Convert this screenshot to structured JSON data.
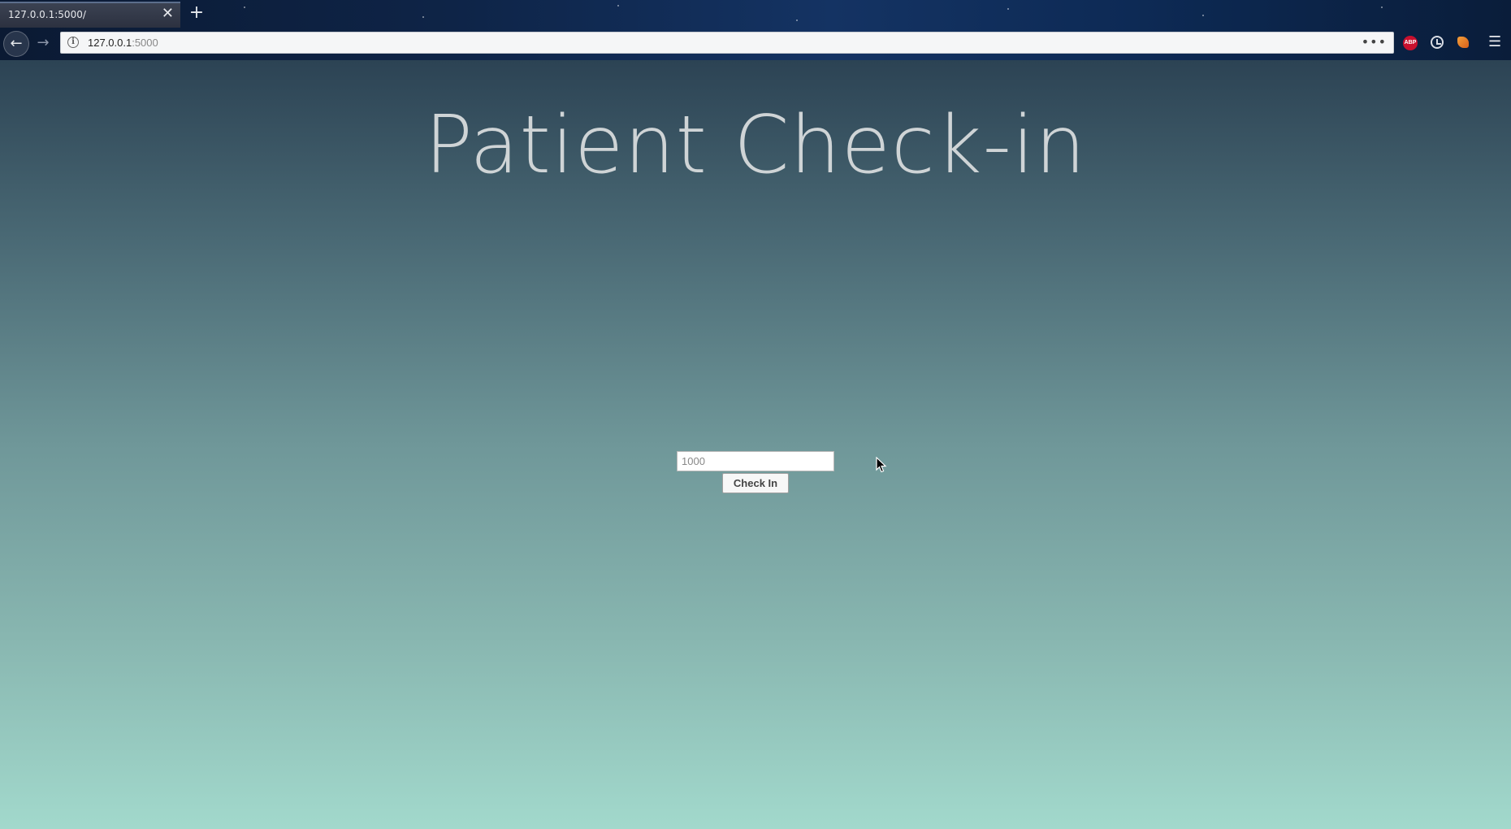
{
  "browser": {
    "tab_title": "127.0.0.1:5000/",
    "tab_close_glyph": "✕",
    "new_tab_glyph": "+",
    "back_glyph": "←",
    "forward_glyph": "→",
    "url_host": "127.0.0.1",
    "url_port": ":5000",
    "more_glyph": "•••",
    "adblock_label": "ABP",
    "menu_glyph": "☰",
    "icons": [
      "back-icon",
      "forward-icon",
      "info-icon",
      "more-icon",
      "adblock-icon",
      "history-icon",
      "fox-icon",
      "menu-icon"
    ]
  },
  "page": {
    "title": "Patient Check-in",
    "input": {
      "placeholder": "1000",
      "value": ""
    },
    "button_label": "Check In"
  },
  "colors": {
    "gradient_top": "#2c4354",
    "gradient_bottom": "#a2d9cc",
    "title_color": "#cfd4d6"
  }
}
